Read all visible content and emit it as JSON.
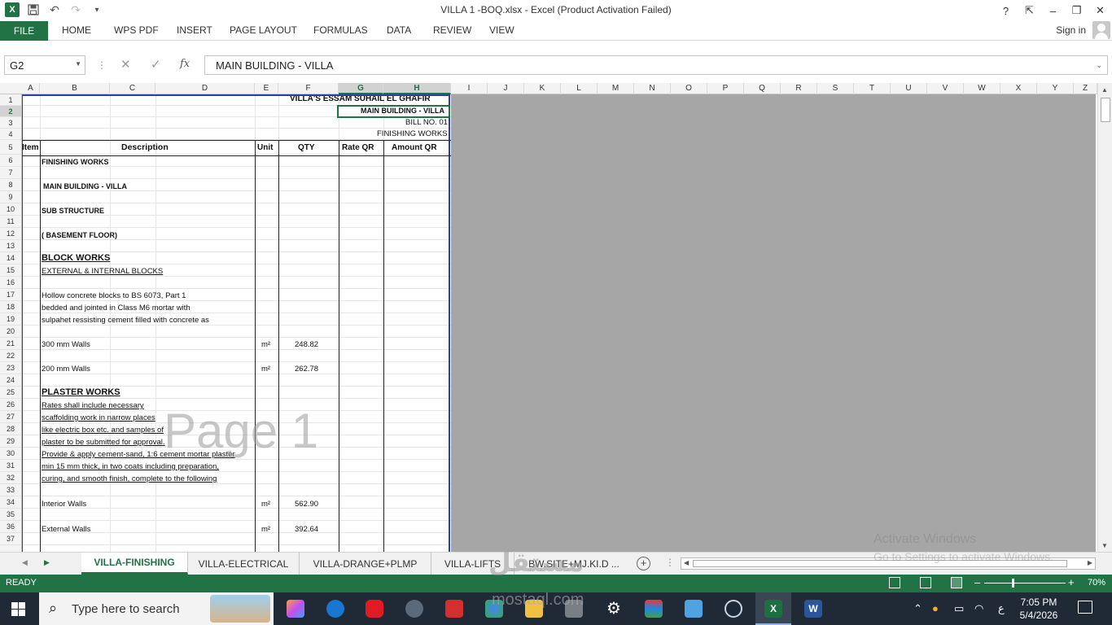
{
  "window": {
    "title": "VILLA 1 -BOQ.xlsx - Excel (Product Activation Failed)",
    "help": "?",
    "restore_ribbon": "⇱",
    "minimize": "–",
    "maximize": "❐",
    "close": "✕"
  },
  "qat": {
    "excel_logo": "X",
    "undo": "↶",
    "redo": "↷",
    "customize": "▾"
  },
  "ribbon": {
    "file": "FILE",
    "tabs": [
      "HOME",
      "WPS PDF",
      "INSERT",
      "PAGE LAYOUT",
      "FORMULAS",
      "DATA",
      "REVIEW",
      "VIEW"
    ],
    "signin": "Sign in"
  },
  "formula_bar": {
    "name_box": "G2",
    "cancel": "✕",
    "enter": "✓",
    "fx": "fx",
    "content": "MAIN BUILDING - VILLA"
  },
  "columns": [
    "A",
    "B",
    "C",
    "D",
    "E",
    "F",
    "G",
    "H",
    "I",
    "J",
    "K",
    "L",
    "M",
    "N",
    "O",
    "P",
    "Q",
    "R",
    "S",
    "T",
    "U",
    "V",
    "W",
    "X",
    "Y",
    "Z"
  ],
  "rows": [
    "1",
    "2",
    "3",
    "4",
    "5",
    "6",
    "7",
    "8",
    "9",
    "10",
    "11",
    "12",
    "13",
    "14",
    "15",
    "16",
    "17",
    "18",
    "19",
    "20",
    "21",
    "22",
    "23",
    "24",
    "25",
    "26",
    "27",
    "28",
    "29",
    "30",
    "31",
    "32",
    "33",
    "34",
    "35",
    "36",
    "37"
  ],
  "sheet": {
    "title1": "VILLA'S ESSAM SUHAIL EL GHAFIR",
    "title2": "MAIN BUILDING - VILLA",
    "title3": "BILL NO. 01",
    "title4": "FINISHING WORKS",
    "header": {
      "item": "Item",
      "description": "Description",
      "unit": "Unit",
      "qty": "QTY",
      "rate": "Rate QR",
      "amount": "Amount QR"
    },
    "r6": "FINISHING WORKS",
    "r8": "MAIN BUILDING - VILLA",
    "r10": "SUB STRUCTURE",
    "r12": "( BASEMENT FLOOR)",
    "r14": "BLOCK WORKS",
    "r15": "EXTERNAL & INTERNAL BLOCKS",
    "r17": "Hollow concrete blocks to BS 6073, Part 1",
    "r18": "bedded and jointed in Class M6 mortar with",
    "r19": "sulpahet ressisting cement filled with concrete as",
    "r21": {
      "desc": "300 mm Walls",
      "unit": "m²",
      "qty": "248.82"
    },
    "r23": {
      "desc": "200 mm Walls",
      "unit": "m²",
      "qty": "262.78"
    },
    "r25": "PLASTER WORKS",
    "r26": "Rates shall include necessary",
    "r27": "scaffolding work in narrow places",
    "r28": " like electric box etc. and samples of",
    "r29": "plaster to be submitted for approval.",
    "r30": "Provide & apply cement-sand, 1:6 cement mortar plaster",
    "r31": "  min 15 mm thick, in two coats including preparation,",
    "r32": "curing, and smooth finish, complete to the following",
    "r34": {
      "desc": "Interior Walls",
      "unit": "m²",
      "qty": "562.90"
    },
    "r36": {
      "desc": "External Walls",
      "unit": "m²",
      "qty": "392.64"
    }
  },
  "page_watermark": "Page 1",
  "sheet_tabs": [
    "VILLA-FINISHING",
    "VILLA-ELECTRICAL",
    "VILLA-DRANGE+PLMP",
    "VILLA-LIFTS",
    "BW.SITE+MJ.KI.D ..."
  ],
  "activate": {
    "line1": "Activate Windows",
    "line2": "Go to Settings to activate Windows."
  },
  "status": {
    "text": "READY",
    "zoom_minus": "–",
    "zoom_plus": "+",
    "zoom": "70%"
  },
  "zoom_level_percent": 70,
  "taskbar": {
    "search_placeholder": "Type here to search",
    "time": "7:05 PM",
    "date": "5/4/2026",
    "lang": "ع",
    "excel_label": "X",
    "word_label": "W"
  },
  "mostaql": {
    "ar": "مستقل",
    "en": "mostaql.com"
  },
  "colors": {
    "excel_green": "#217346",
    "page_border": "#2b3fa8",
    "grey": "#a6a6a6"
  }
}
